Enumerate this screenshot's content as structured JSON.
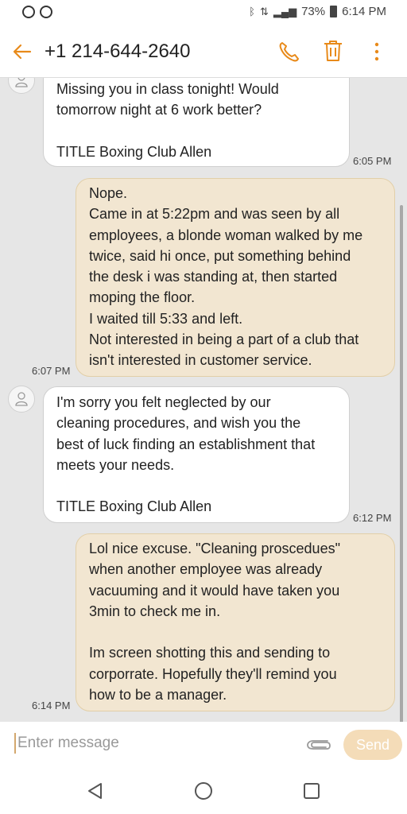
{
  "status_bar": {
    "battery": "73%",
    "time": "6:14 PM"
  },
  "header": {
    "back_icon": "arrow-left-icon",
    "contact": "+1 214-644-2640",
    "actions": [
      "phone-icon",
      "trash-icon",
      "more-vert-icon"
    ],
    "accent_color": "#e88a1a"
  },
  "messages": [
    {
      "direction": "incoming",
      "lines": [
        "Missing you in class tonight! Would",
        "tomorrow night at 6 work better?",
        "",
        "TITLE Boxing Club Allen"
      ],
      "time": "6:05 PM"
    },
    {
      "direction": "outgoing",
      "lines": [
        "Nope.",
        "Came in at 5:22pm and was seen by all",
        "employees, a blonde woman walked by me",
        "twice, said hi once, put something behind",
        "the desk i was standing at, then started",
        "moping the floor.",
        "I waited till 5:33 and left.",
        "Not interested in being a part of a club that",
        "isn't interested in customer service."
      ],
      "time": "6:07 PM"
    },
    {
      "direction": "incoming",
      "lines": [
        "I'm sorry you felt neglected by our",
        "cleaning procedures, and wish you the",
        "best of luck finding an establishment that",
        "meets your needs.",
        "",
        "TITLE Boxing Club Allen"
      ],
      "time": "6:12 PM"
    },
    {
      "direction": "outgoing",
      "lines": [
        "Lol nice excuse. \"Cleaning proscedues\"",
        "when another employee was already",
        "vacuuming and it would have taken you",
        "3min to check me in.",
        "",
        "Im screen shotting this and sending to",
        "corporrate. Hopefully they'll remind you",
        "how to be a manager."
      ],
      "time": "6:14 PM"
    }
  ],
  "composer": {
    "placeholder": "Enter message",
    "send_label": "Send"
  },
  "nav": [
    "back-triangle-icon",
    "home-circle-icon",
    "recents-square-icon"
  ]
}
